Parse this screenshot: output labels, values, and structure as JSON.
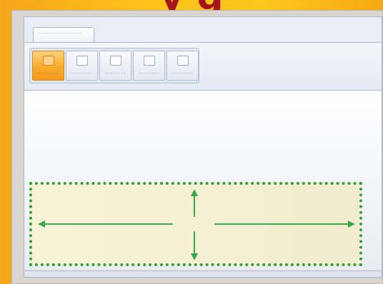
{
  "slide": {
    "title": "y g"
  },
  "ribbon": {
    "tab_label": "~~~~~~~~~~~~~~~~",
    "buttons": [
      {
        "label": "~~~~~~~~",
        "active": true
      },
      {
        "label": "~~~~~~~~",
        "active": false
      },
      {
        "label": "~~~~~~~~",
        "active": false
      },
      {
        "label": "~~~~~~~~",
        "active": false
      },
      {
        "label": "~~~~~~~~",
        "active": false
      }
    ]
  },
  "icons": {
    "resize_arrows": "four-way-resize-arrows-icon",
    "button_icon": "placeholder-square-icon"
  },
  "colors": {
    "background": "#ffc31c",
    "title": "#a4161a",
    "highlight_border": "#2f9f45",
    "highlight_fill": "#f6f0d5",
    "active_button": "#f6ac2c"
  }
}
